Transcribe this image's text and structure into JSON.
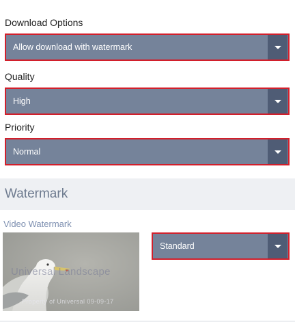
{
  "download_options": {
    "label": "Download Options",
    "selected": "Allow download with watermark"
  },
  "quality": {
    "label": "Quality",
    "selected": "High"
  },
  "priority": {
    "label": "Priority",
    "selected": "Normal"
  },
  "watermark_section": {
    "title": "Watermark"
  },
  "video_watermark": {
    "label": "Video Watermark",
    "preview_overlay_text": "Universal Landscape",
    "preview_caption": "Property of Universal 09-09-17",
    "selected": "Standard"
  },
  "colors": {
    "select_bg": "#75839a",
    "select_arrow_bg": "#4f5c75",
    "highlight_border": "#d21f2b",
    "section_bg": "#eef0f3",
    "link_label": "#7d8fb0"
  },
  "icons": {
    "dropdown": "chevron-down-icon"
  }
}
